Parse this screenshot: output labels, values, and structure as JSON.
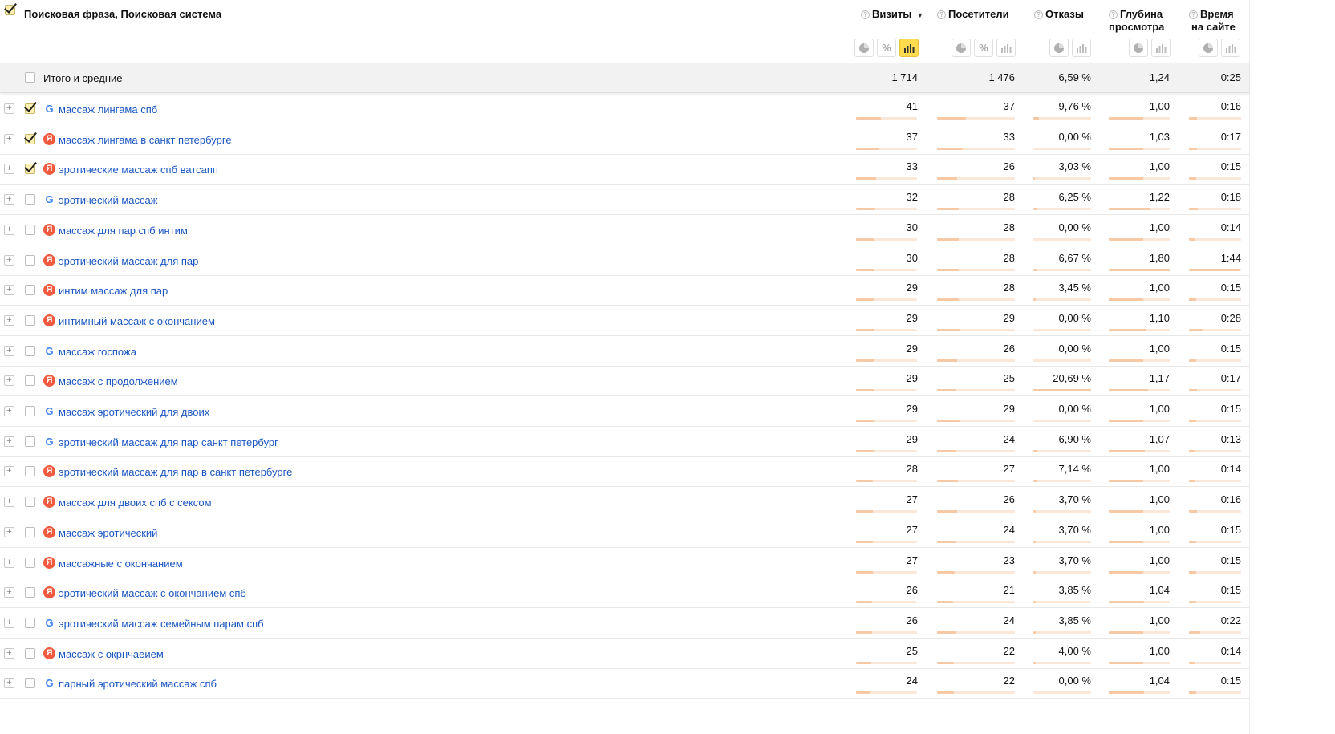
{
  "header": {
    "dimension_title": "Поисковая фраза, Поисковая система",
    "metrics": [
      {
        "key": "visits",
        "label": "Визиты",
        "sorted": true
      },
      {
        "key": "visitors",
        "label": "Посетители"
      },
      {
        "key": "bounce",
        "label": "Отказы"
      },
      {
        "key": "depth",
        "label": "Глубина просмотра",
        "label_line1": "Глубина",
        "label_line2": "просмотра"
      },
      {
        "key": "time",
        "label": "Время на сайте",
        "label_line1": "Время",
        "label_line2": "на сайте"
      }
    ],
    "sort_indicator": "▼",
    "help_glyph": "?"
  },
  "totals": {
    "label": "Итого и средние",
    "visits": "1 714",
    "visitors": "1 476",
    "bounce": "6,59 %",
    "depth": "1,24",
    "time": "0:25"
  },
  "colors": {
    "accent": "#ffdb4d",
    "link": "#1a56c2",
    "yandex": "#f25a3f",
    "google": "#4285f4",
    "bar": "#f6c8a3"
  },
  "rows": [
    {
      "phrase": "массаж лингама спб",
      "engine": "google",
      "checked": true,
      "visits": "41",
      "visitors": "37",
      "bounce": "9,76 %",
      "depth": "1,00",
      "time": "0:16",
      "bars": [
        0.41,
        0.37,
        0.1,
        0.56,
        0.15
      ]
    },
    {
      "phrase": "массаж лингама в санкт петербурге",
      "engine": "yandex",
      "checked": true,
      "visits": "37",
      "visitors": "33",
      "bounce": "0,00 %",
      "depth": "1,03",
      "time": "0:17",
      "bars": [
        0.37,
        0.33,
        0.0,
        0.57,
        0.16
      ]
    },
    {
      "phrase": "эротические массаж спб ватсапп",
      "engine": "yandex",
      "checked": true,
      "visits": "33",
      "visitors": "26",
      "bounce": "3,03 %",
      "depth": "1,00",
      "time": "0:15",
      "bars": [
        0.33,
        0.26,
        0.03,
        0.56,
        0.14
      ]
    },
    {
      "phrase": "эротический массаж",
      "engine": "google",
      "checked": false,
      "visits": "32",
      "visitors": "28",
      "bounce": "6,25 %",
      "depth": "1,22",
      "time": "0:18",
      "bars": [
        0.32,
        0.28,
        0.07,
        0.68,
        0.17
      ]
    },
    {
      "phrase": "массаж для пар спб интим",
      "engine": "yandex",
      "checked": false,
      "visits": "30",
      "visitors": "28",
      "bounce": "0,00 %",
      "depth": "1,00",
      "time": "0:14",
      "bars": [
        0.3,
        0.28,
        0.0,
        0.56,
        0.13
      ]
    },
    {
      "phrase": "эротический массаж для пар",
      "engine": "yandex",
      "checked": false,
      "visits": "30",
      "visitors": "28",
      "bounce": "6,67 %",
      "depth": "1,80",
      "time": "1:44",
      "bars": [
        0.3,
        0.28,
        0.07,
        1.0,
        0.97
      ]
    },
    {
      "phrase": "интим массаж для пар",
      "engine": "yandex",
      "checked": false,
      "visits": "29",
      "visitors": "28",
      "bounce": "3,45 %",
      "depth": "1,00",
      "time": "0:15",
      "bars": [
        0.29,
        0.28,
        0.04,
        0.56,
        0.14
      ]
    },
    {
      "phrase": "интимный массаж с окончанием",
      "engine": "yandex",
      "checked": false,
      "visits": "29",
      "visitors": "29",
      "bounce": "0,00 %",
      "depth": "1,10",
      "time": "0:28",
      "bars": [
        0.29,
        0.29,
        0.0,
        0.61,
        0.26
      ]
    },
    {
      "phrase": "массаж госпожа",
      "engine": "google",
      "checked": false,
      "visits": "29",
      "visitors": "26",
      "bounce": "0,00 %",
      "depth": "1,00",
      "time": "0:15",
      "bars": [
        0.29,
        0.26,
        0.0,
        0.56,
        0.14
      ]
    },
    {
      "phrase": "массаж с продолжением",
      "engine": "yandex",
      "checked": false,
      "visits": "29",
      "visitors": "25",
      "bounce": "20,69 %",
      "depth": "1,17",
      "time": "0:17",
      "bars": [
        0.29,
        0.25,
        1.0,
        0.65,
        0.16
      ]
    },
    {
      "phrase": "массаж эротический для двоих",
      "engine": "google",
      "checked": false,
      "visits": "29",
      "visitors": "29",
      "bounce": "0,00 %",
      "depth": "1,00",
      "time": "0:15",
      "bars": [
        0.29,
        0.29,
        0.0,
        0.56,
        0.14
      ]
    },
    {
      "phrase": "эротический массаж для пар санкт петербург",
      "engine": "google",
      "checked": false,
      "visits": "29",
      "visitors": "24",
      "bounce": "6,90 %",
      "depth": "1,07",
      "time": "0:13",
      "bars": [
        0.29,
        0.24,
        0.07,
        0.59,
        0.12
      ]
    },
    {
      "phrase": "эротический массаж для пар в санкт петербурге",
      "engine": "yandex",
      "checked": false,
      "visits": "28",
      "visitors": "27",
      "bounce": "7,14 %",
      "depth": "1,00",
      "time": "0:14",
      "bars": [
        0.28,
        0.27,
        0.07,
        0.56,
        0.13
      ]
    },
    {
      "phrase": "массаж для двоих спб с сексом",
      "engine": "yandex",
      "checked": false,
      "visits": "27",
      "visitors": "26",
      "bounce": "3,70 %",
      "depth": "1,00",
      "time": "0:16",
      "bars": [
        0.27,
        0.26,
        0.04,
        0.56,
        0.15
      ]
    },
    {
      "phrase": "массаж эротический",
      "engine": "yandex",
      "checked": false,
      "visits": "27",
      "visitors": "24",
      "bounce": "3,70 %",
      "depth": "1,00",
      "time": "0:15",
      "bars": [
        0.27,
        0.24,
        0.04,
        0.56,
        0.14
      ]
    },
    {
      "phrase": "массажные с окончанием",
      "engine": "yandex",
      "checked": false,
      "visits": "27",
      "visitors": "23",
      "bounce": "3,70 %",
      "depth": "1,00",
      "time": "0:15",
      "bars": [
        0.27,
        0.23,
        0.04,
        0.56,
        0.14
      ]
    },
    {
      "phrase": "эротический массаж с окончанием спб",
      "engine": "yandex",
      "checked": false,
      "visits": "26",
      "visitors": "21",
      "bounce": "3,85 %",
      "depth": "1,04",
      "time": "0:15",
      "bars": [
        0.26,
        0.21,
        0.04,
        0.58,
        0.14
      ]
    },
    {
      "phrase": "эротический массаж семейным парам спб",
      "engine": "google",
      "checked": false,
      "visits": "26",
      "visitors": "24",
      "bounce": "3,85 %",
      "depth": "1,00",
      "time": "0:22",
      "bars": [
        0.26,
        0.24,
        0.04,
        0.56,
        0.21
      ]
    },
    {
      "phrase": "массаж с окрнчаеием",
      "engine": "yandex",
      "checked": false,
      "visits": "25",
      "visitors": "22",
      "bounce": "4,00 %",
      "depth": "1,00",
      "time": "0:14",
      "bars": [
        0.25,
        0.22,
        0.04,
        0.56,
        0.13
      ]
    },
    {
      "phrase": "парный эротический массаж спб",
      "engine": "google",
      "checked": false,
      "visits": "24",
      "visitors": "22",
      "bounce": "0,00 %",
      "depth": "1,04",
      "time": "0:15",
      "bars": [
        0.24,
        0.22,
        0.0,
        0.58,
        0.14
      ]
    }
  ]
}
